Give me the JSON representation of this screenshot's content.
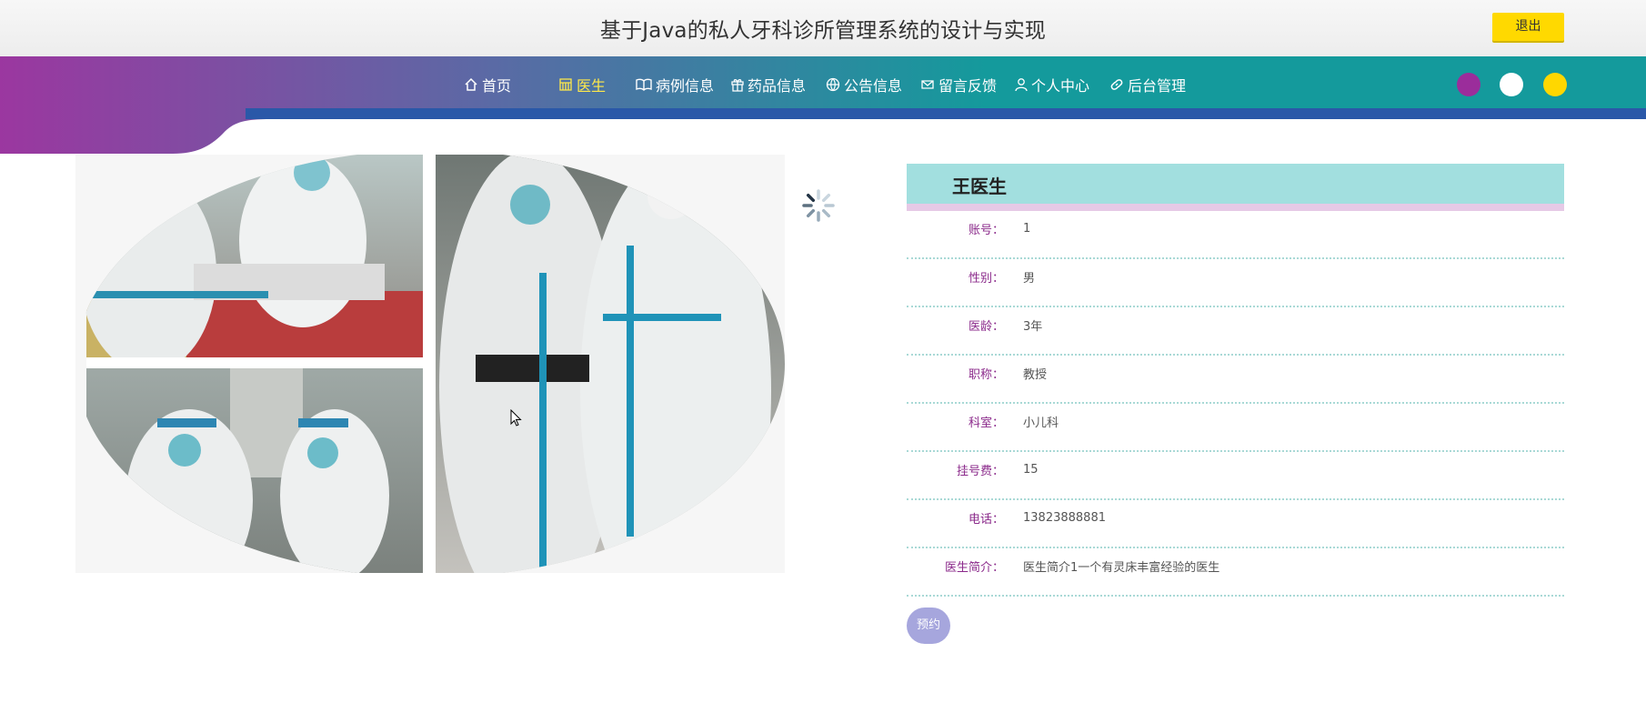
{
  "header": {
    "title": "基于Java的私人牙科诊所管理系统的设计与实现",
    "logout_label": "退出"
  },
  "nav": {
    "items": [
      {
        "label": "首页",
        "icon": "home-icon",
        "active": false
      },
      {
        "label": "医生",
        "icon": "grid-icon",
        "active": true
      },
      {
        "label": "病例信息",
        "icon": "book-icon",
        "active": false
      },
      {
        "label": "药品信息",
        "icon": "gift-icon",
        "active": false
      },
      {
        "label": "公告信息",
        "icon": "globe-icon",
        "active": false
      },
      {
        "label": "留言反馈",
        "icon": "mail-icon",
        "active": false
      },
      {
        "label": "个人中心",
        "icon": "user-icon",
        "active": false
      },
      {
        "label": "后台管理",
        "icon": "link-icon",
        "active": false
      }
    ],
    "theme_dots": [
      "#9b2d9b",
      "#ffffff",
      "#ffd700"
    ]
  },
  "colors": {
    "nav_gradient_start": "#9b37a0",
    "nav_gradient_end": "#149a9c",
    "accent_yellow": "#ffd900",
    "label_color": "#8b2a8b"
  },
  "doctor": {
    "name": "王医生",
    "fields": [
      {
        "label": "账号：",
        "value": "1"
      },
      {
        "label": "性别：",
        "value": "男"
      },
      {
        "label": "医龄：",
        "value": "3年"
      },
      {
        "label": "职称：",
        "value": "教授"
      },
      {
        "label": "科室：",
        "value": "小儿科"
      },
      {
        "label": "挂号费：",
        "value": "15"
      },
      {
        "label": "电话：",
        "value": "13823888881"
      },
      {
        "label": "医生简介：",
        "value": "医生简介1一个有灵床丰富经验的医生"
      }
    ],
    "book_label": "预约"
  }
}
